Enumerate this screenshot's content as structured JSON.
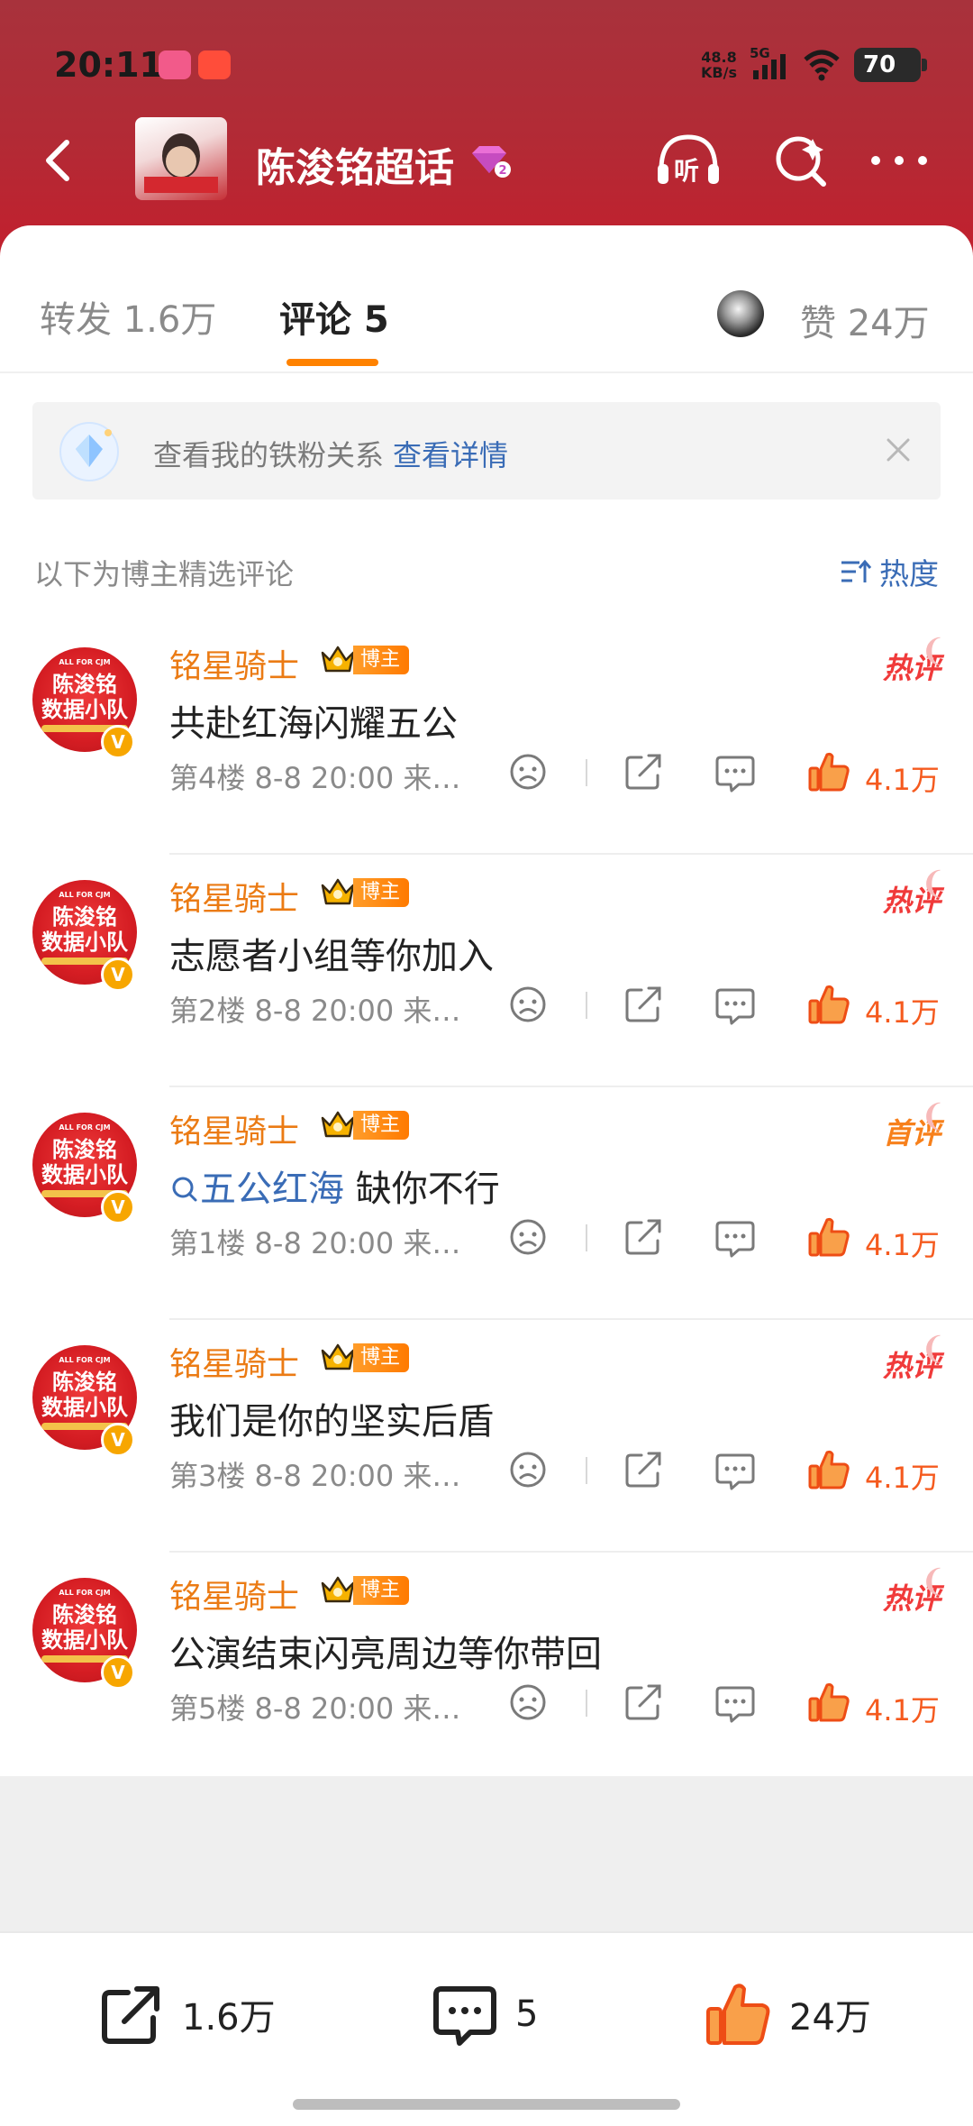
{
  "status_bar": {
    "time": "20:11",
    "net_speed_value": "48.8",
    "net_speed_unit": "KB/s",
    "network": "5G",
    "battery": "70"
  },
  "header": {
    "title": "陈浚铭超话",
    "icons": [
      "back-icon",
      "listen-icon",
      "search-icon",
      "more-icon"
    ],
    "listen_label": "听"
  },
  "tabs": [
    {
      "label": "转发 1.6万"
    },
    {
      "label": "评论 5"
    }
  ],
  "likes_tab": "赞 24万",
  "fan_banner": {
    "text": "查看我的铁粉关系",
    "link": "查看详情"
  },
  "comments_header": {
    "label": "以下为博主精选评论",
    "sort": "热度"
  },
  "avatar_text": {
    "line1": "陈浚铭",
    "line2": "数据小队",
    "small": "ALL FOR CJM",
    "badge": "V"
  },
  "comments": [
    {
      "user": "铭星骑士",
      "badge": "博主",
      "tag": "热评",
      "text": "共赴红海闪耀五公",
      "meta": "第4楼  8-8 20:00  来…",
      "likes": "4.1万"
    },
    {
      "user": "铭星骑士",
      "badge": "博主",
      "tag": "热评",
      "text": "志愿者小组等你加入",
      "meta": "第2楼  8-8 20:00  来…",
      "likes": "4.1万"
    },
    {
      "user": "铭星骑士",
      "badge": "博主",
      "tag": "首评",
      "topic": "五公红海",
      "text": " 缺你不行",
      "meta": "第1楼  8-8 20:00  来…",
      "likes": "4.1万"
    },
    {
      "user": "铭星骑士",
      "badge": "博主",
      "tag": "热评",
      "text": "我们是你的坚实后盾",
      "meta": "第3楼  8-8 20:00  来…",
      "likes": "4.1万"
    },
    {
      "user": "铭星骑士",
      "badge": "博主",
      "tag": "热评",
      "text": "公演结束闪亮周边等你带回",
      "meta": "第5楼  8-8 20:00  来…",
      "likes": "4.1万"
    }
  ],
  "bottom_bar": {
    "repost": "1.6万",
    "comment": "5",
    "like": "24万"
  },
  "colors": {
    "header_red": "#b32a35",
    "accent_orange": "#ff8200",
    "username_orange": "#eb7b14",
    "link_blue": "#3a6cb6",
    "like_red": "#f55a1e"
  }
}
